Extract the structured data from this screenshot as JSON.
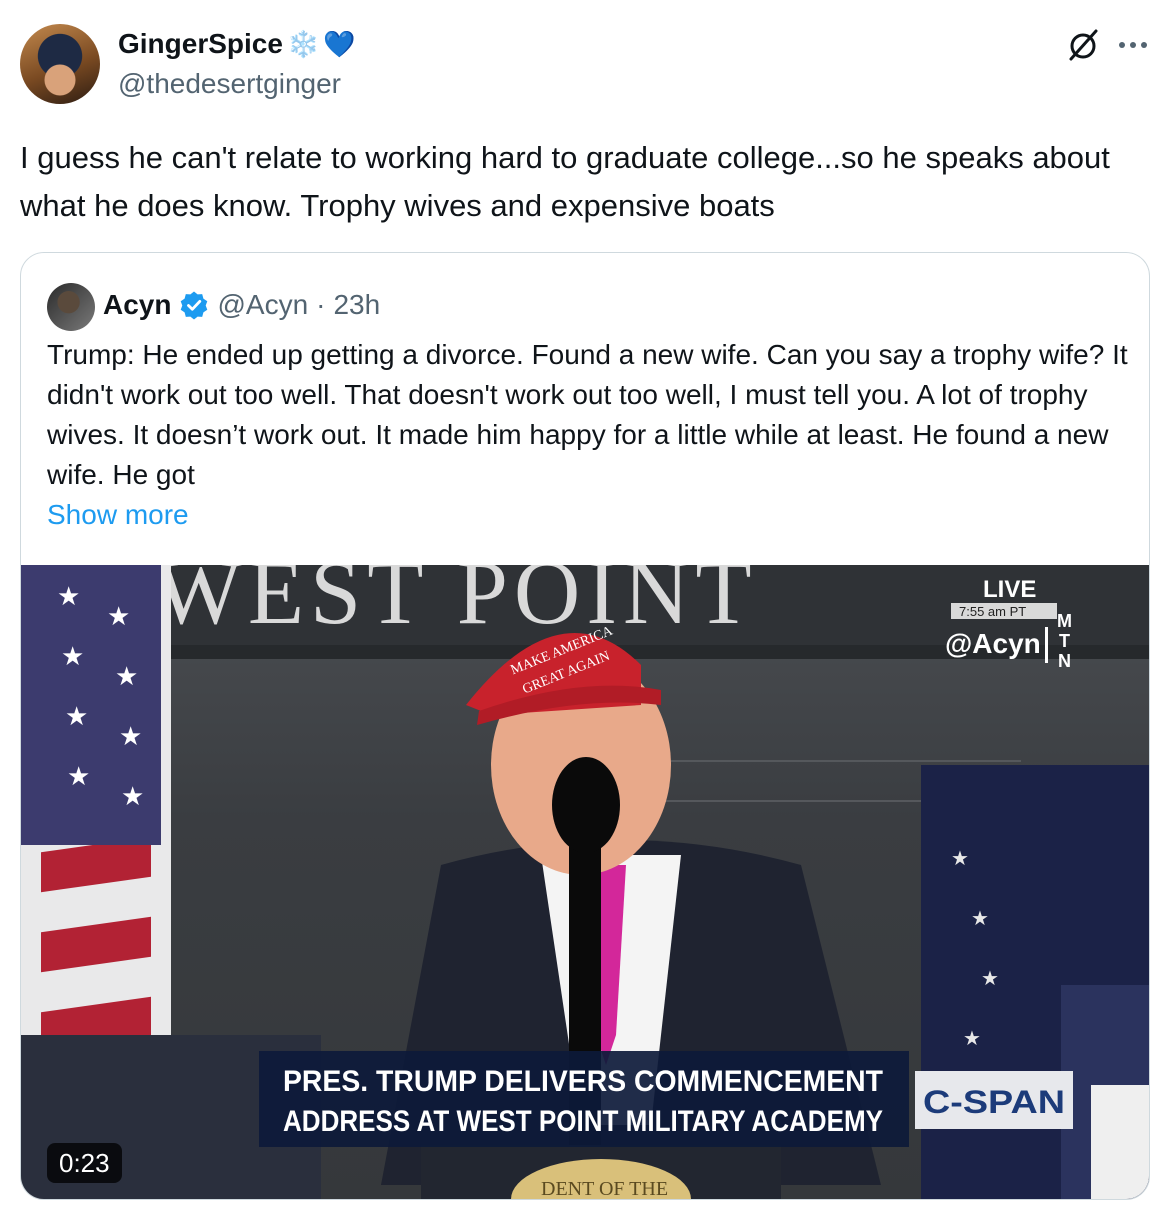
{
  "tweet": {
    "author": {
      "display_name": "GingerSpice",
      "name_emojis": [
        "❄️",
        "💙"
      ],
      "handle": "@thedesertginger"
    },
    "text": "I guess he can't relate to working hard to graduate college...so he speaks about what he does know. Trophy wives and expensive boats",
    "icons": {
      "grok": "grok-icon",
      "more": "more-icon"
    }
  },
  "quoted_tweet": {
    "author": {
      "display_name": "Acyn",
      "verified": true,
      "handle": "@Acyn",
      "separator": "·",
      "time": "23h"
    },
    "text": "Trump: He ended up getting a divorce. Found a new wife. Can you say a trophy wife? It didn't work out too well. That doesn't work out too well, I must tell you. A lot of trophy wives. It doesn’t work out. It made him happy for a little while at least. He found a new wife. He got",
    "show_more": "Show more",
    "video": {
      "duration": "0:23",
      "backdrop_text": "WEST POINT",
      "hat_text_line1": "MAKE AMERICA",
      "hat_text_line2": "GREAT AGAIN",
      "live_label": "LIVE",
      "live_time": "7:55 am PT",
      "watermark": "@Acyn",
      "mtn": [
        "M",
        "T",
        "N"
      ],
      "chyron_line1": "PRES. TRUMP DELIVERS COMMENCEMENT",
      "chyron_line2": "ADDRESS AT WEST POINT MILITARY ACADEMY",
      "network": "C-SPAN",
      "seal_text": "DENT OF THE"
    }
  },
  "colors": {
    "text": "#0f1419",
    "secondary": "#536471",
    "link": "#1d9bf0",
    "border": "#cfd9de",
    "verified": "#1d9bf0",
    "hat": "#c8222c",
    "tie": "#d3279a",
    "chyron_bg": "#0d1a3a"
  }
}
